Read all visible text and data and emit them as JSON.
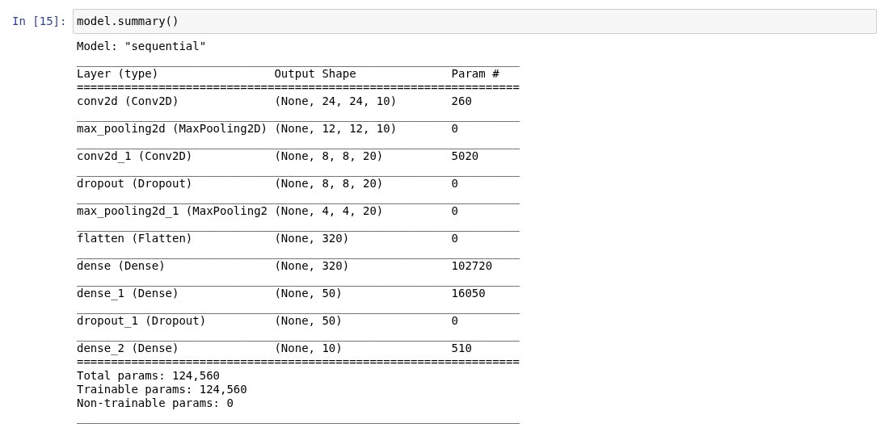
{
  "cell": {
    "prompt": "In [15]:",
    "code": "model.summary()"
  },
  "output": [
    {
      "kind": "text",
      "text": "Model: \"sequential\""
    },
    {
      "kind": "rule",
      "text": "_________________________________________________________________"
    },
    {
      "kind": "row",
      "cells": [
        "Layer (type)",
        "Output Shape",
        "Param #"
      ]
    },
    {
      "kind": "rule",
      "text": "================================================================="
    },
    {
      "kind": "row",
      "cells": [
        "conv2d (Conv2D)",
        "(None, 24, 24, 10)",
        "260"
      ]
    },
    {
      "kind": "rule",
      "text": "_________________________________________________________________"
    },
    {
      "kind": "row",
      "cells": [
        "max_pooling2d (MaxPooling2D)",
        "(None, 12, 12, 10)",
        "0"
      ]
    },
    {
      "kind": "rule",
      "text": "_________________________________________________________________"
    },
    {
      "kind": "row",
      "cells": [
        "conv2d_1 (Conv2D)",
        "(None, 8, 8, 20)",
        "5020"
      ]
    },
    {
      "kind": "rule",
      "text": "_________________________________________________________________"
    },
    {
      "kind": "row",
      "cells": [
        "dropout (Dropout)",
        "(None, 8, 8, 20)",
        "0"
      ]
    },
    {
      "kind": "rule",
      "text": "_________________________________________________________________"
    },
    {
      "kind": "row",
      "cells": [
        "max_pooling2d_1 (MaxPooling2",
        "(None, 4, 4, 20)",
        "0"
      ]
    },
    {
      "kind": "rule",
      "text": "_________________________________________________________________"
    },
    {
      "kind": "row",
      "cells": [
        "flatten (Flatten)",
        "(None, 320)",
        "0"
      ]
    },
    {
      "kind": "rule",
      "text": "_________________________________________________________________"
    },
    {
      "kind": "row",
      "cells": [
        "dense (Dense)",
        "(None, 320)",
        "102720"
      ]
    },
    {
      "kind": "rule",
      "text": "_________________________________________________________________"
    },
    {
      "kind": "row",
      "cells": [
        "dense_1 (Dense)",
        "(None, 50)",
        "16050"
      ]
    },
    {
      "kind": "rule",
      "text": "_________________________________________________________________"
    },
    {
      "kind": "row",
      "cells": [
        "dropout_1 (Dropout)",
        "(None, 50)",
        "0"
      ]
    },
    {
      "kind": "rule",
      "text": "_________________________________________________________________"
    },
    {
      "kind": "row",
      "cells": [
        "dense_2 (Dense)",
        "(None, 10)",
        "510"
      ]
    },
    {
      "kind": "rule",
      "text": "================================================================="
    },
    {
      "kind": "text",
      "text": "Total params: 124,560"
    },
    {
      "kind": "text",
      "text": "Trainable params: 124,560"
    },
    {
      "kind": "text",
      "text": "Non-trainable params: 0"
    },
    {
      "kind": "rule",
      "text": "_________________________________________________________________"
    }
  ]
}
